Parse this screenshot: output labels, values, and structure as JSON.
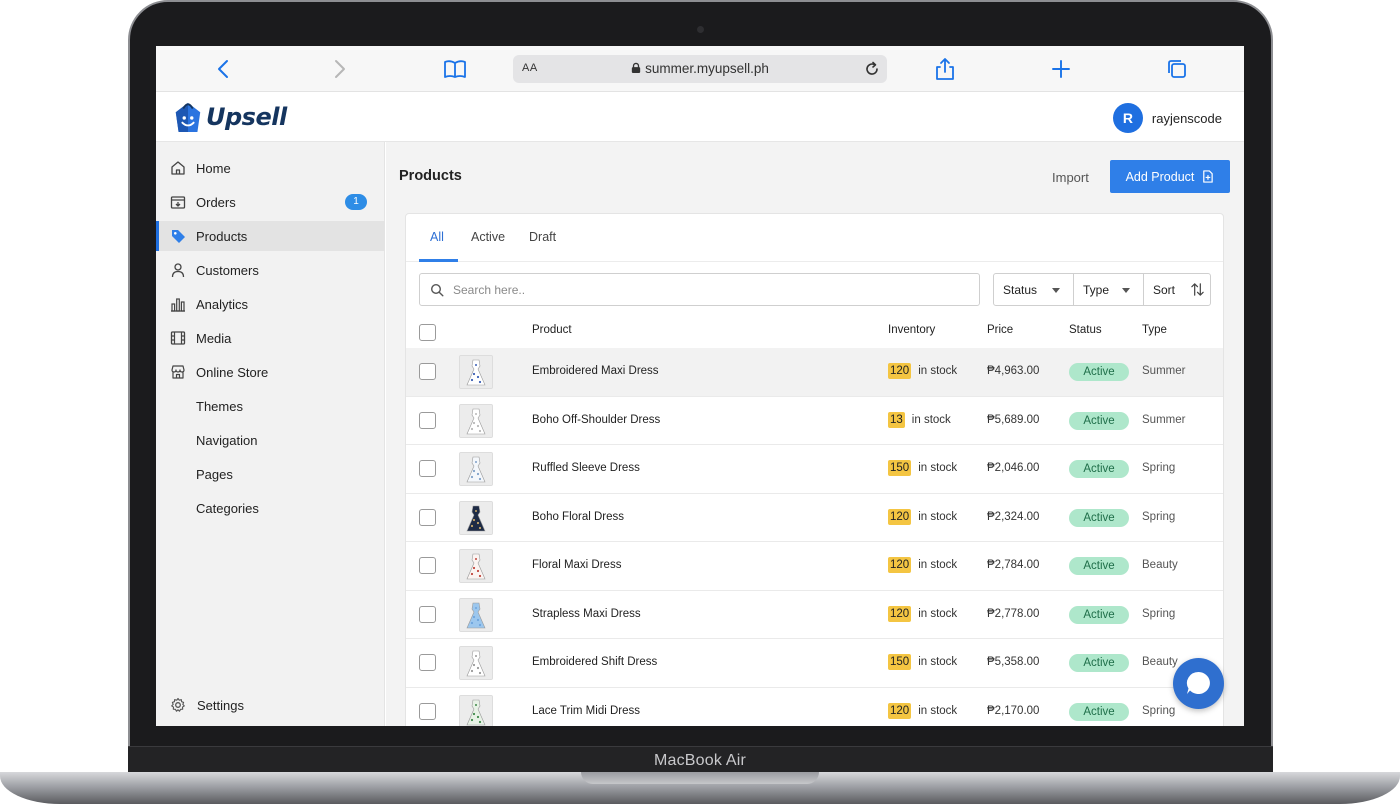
{
  "device": {
    "model_label": "MacBook Air"
  },
  "browser": {
    "aa_label": "AA",
    "url": "summer.myupsell.ph"
  },
  "app": {
    "logo_text": "Upsell",
    "user": {
      "initial": "R",
      "name": "rayjenscode"
    }
  },
  "sidebar": {
    "items": [
      {
        "label": "Home",
        "icon": "home-icon"
      },
      {
        "label": "Orders",
        "icon": "orders-icon",
        "badge": "1"
      },
      {
        "label": "Products",
        "icon": "tag-icon",
        "active": true
      },
      {
        "label": "Customers",
        "icon": "person-icon"
      },
      {
        "label": "Analytics",
        "icon": "bar-chart-icon"
      },
      {
        "label": "Media",
        "icon": "film-icon"
      },
      {
        "label": "Online Store",
        "icon": "store-icon"
      },
      {
        "label": "Themes",
        "sub": true
      },
      {
        "label": "Navigation",
        "sub": true
      },
      {
        "label": "Pages",
        "sub": true
      },
      {
        "label": "Categories",
        "sub": true
      }
    ],
    "settings_label": "Settings"
  },
  "main": {
    "title": "Products",
    "import_label": "Import",
    "add_label": "Add Product",
    "tabs": [
      "All",
      "Active",
      "Draft"
    ],
    "active_tab": "All",
    "search_placeholder": "Search here..",
    "filters": {
      "status": "Status",
      "type": "Type",
      "sort": "Sort"
    },
    "columns": {
      "product": "Product",
      "inventory": "Inventory",
      "price": "Price",
      "status": "Status",
      "type": "Type"
    },
    "stock_suffix": "in stock",
    "rows": [
      {
        "name": "Embroidered Maxi Dress",
        "qty": "120",
        "price": "₱4,963.00",
        "status": "Active",
        "type": "Summer",
        "color": "#ffffff",
        "pattern": "#3b5fb5"
      },
      {
        "name": "Boho Off-Shoulder Dress",
        "qty": "13",
        "price": "₱5,689.00",
        "status": "Active",
        "type": "Summer",
        "color": "#ffffff",
        "pattern": "#b8b8b8"
      },
      {
        "name": "Ruffled Sleeve Dress",
        "qty": "150",
        "price": "₱2,046.00",
        "status": "Active",
        "type": "Spring",
        "color": "#f4f7fb",
        "pattern": "#7fa0c8"
      },
      {
        "name": "Boho Floral Dress",
        "qty": "120",
        "price": "₱2,324.00",
        "status": "Active",
        "type": "Spring",
        "color": "#1e2b45",
        "pattern": "#c8a86a"
      },
      {
        "name": "Floral Maxi Dress",
        "qty": "120",
        "price": "₱2,784.00",
        "status": "Active",
        "type": "Beauty",
        "color": "#fbf4f2",
        "pattern": "#c0453d"
      },
      {
        "name": "Strapless Maxi Dress",
        "qty": "120",
        "price": "₱2,778.00",
        "status": "Active",
        "type": "Spring",
        "color": "#9cc7ee",
        "pattern": "#6ea4dd"
      },
      {
        "name": "Embroidered Shift Dress",
        "qty": "150",
        "price": "₱5,358.00",
        "status": "Active",
        "type": "Beauty",
        "color": "#ffffff",
        "pattern": "#999999"
      },
      {
        "name": "Lace Trim Midi Dress",
        "qty": "120",
        "price": "₱2,170.00",
        "status": "Active",
        "type": "Spring",
        "color": "#e8f2e6",
        "pattern": "#3f8a4a"
      }
    ]
  },
  "colors": {
    "accent": "#2f7fe8",
    "status_active_bg": "#aee7cb",
    "stock_badge": "#f4c542"
  }
}
